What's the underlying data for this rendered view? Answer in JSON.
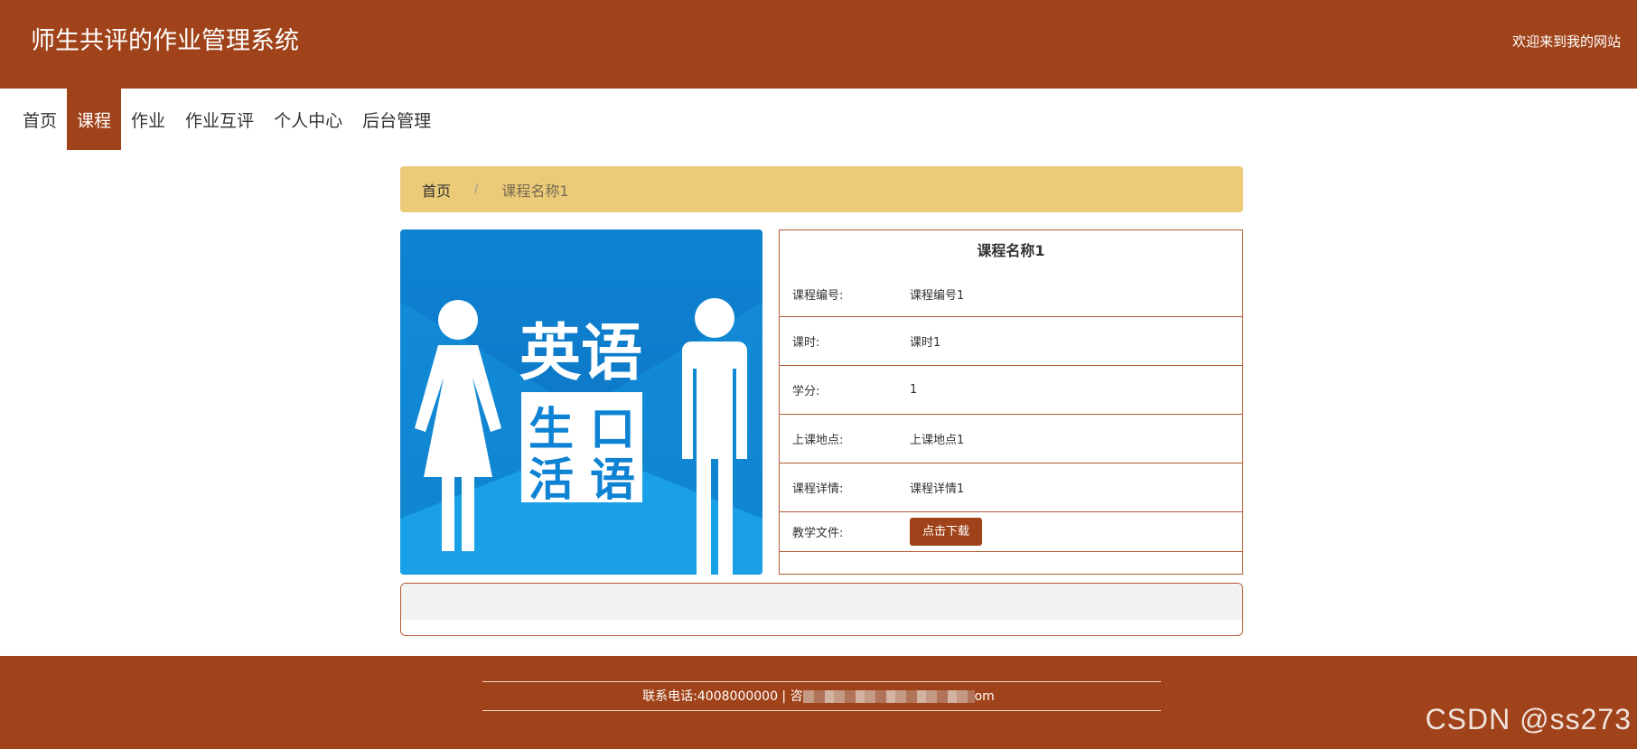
{
  "header": {
    "title": "师生共评的作业管理系统",
    "welcome": "欢迎来到我的网站"
  },
  "nav": {
    "items": [
      {
        "label": "首页",
        "active": false
      },
      {
        "label": "课程",
        "active": true
      },
      {
        "label": "作业",
        "active": false
      },
      {
        "label": "作业互评",
        "active": false
      },
      {
        "label": "个人中心",
        "active": false
      },
      {
        "label": "后台管理",
        "active": false
      }
    ]
  },
  "breadcrumb": {
    "home": "首页",
    "separator": "/",
    "current": "课程名称1"
  },
  "course_image": {
    "text_top": "英语",
    "text_grid": [
      "生",
      "口",
      "活",
      "语"
    ]
  },
  "details": {
    "title": "课程名称1",
    "rows": [
      {
        "label": "课程编号:",
        "value": "课程编号1"
      },
      {
        "label": "课时:",
        "value": "课时1"
      },
      {
        "label": "学分:",
        "value": "1"
      },
      {
        "label": "上课地点:",
        "value": "上课地点1"
      },
      {
        "label": "课程详情:",
        "value": "课程详情1"
      }
    ],
    "file_label": "教学文件:",
    "download_label": "点击下载"
  },
  "footer": {
    "contact_prefix": "联系电话:4008000000 | 咨",
    "contact_suffix": "om"
  },
  "watermark": "CSDN @ss273",
  "colors": {
    "brand": "#A0431A",
    "breadcrumb_bg": "#EBCB77"
  }
}
